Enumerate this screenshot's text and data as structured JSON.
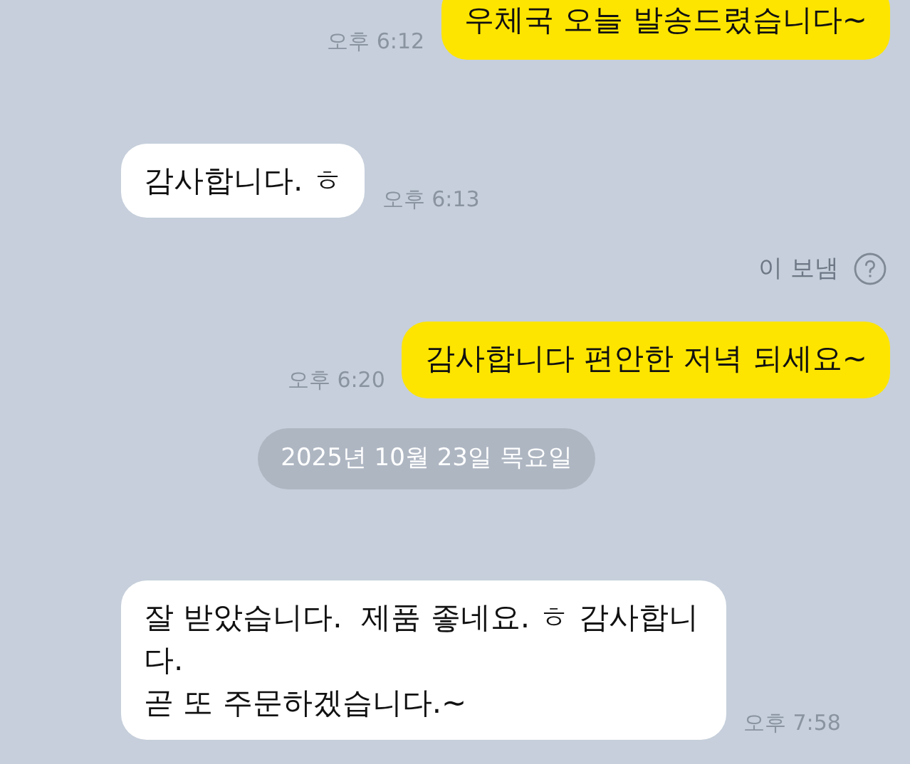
{
  "messages": [
    {
      "kind": "sent",
      "text": "우체국 오늘 발송드렸습니다~",
      "time": "오후 6:12"
    },
    {
      "kind": "received",
      "text": "감사합니다. ㅎ",
      "time": "오후 6:13"
    },
    {
      "kind": "note",
      "text": "이 보냄"
    },
    {
      "kind": "sent",
      "text": "감사합니다 편안한 저녁 되세요~",
      "time": "오후 6:20"
    },
    {
      "kind": "date",
      "text": "2025년 10월 23일 목요일"
    },
    {
      "kind": "received",
      "text": "잘 받았습니다.  제품 좋네요. ㅎ 감사합니다.\n곧 또 주문하겠습니다.~",
      "time": "오후 7:58"
    }
  ]
}
